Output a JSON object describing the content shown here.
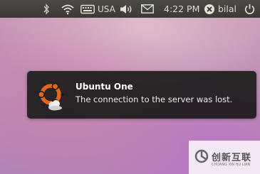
{
  "panel": {
    "keyboard_layout": "USA",
    "clock": "4:22 PM",
    "user": "bilal",
    "icons": [
      "bluetooth-icon",
      "wifi-icon",
      "keyboard-icon",
      "volume-icon",
      "mail-icon",
      "user-status-icon",
      "power-icon"
    ]
  },
  "notification": {
    "title": "Ubuntu One",
    "body": "The connection to the server was lost.",
    "icon": "ubuntu-one-icon"
  },
  "watermark": {
    "text": "创新互联",
    "subtext": "CHUANG XIN HU LIAN"
  },
  "colors": {
    "panel_bg": "#3e3d39",
    "notification_bg": "#1c1b1a",
    "ubuntu_orange": "#e0651d"
  }
}
